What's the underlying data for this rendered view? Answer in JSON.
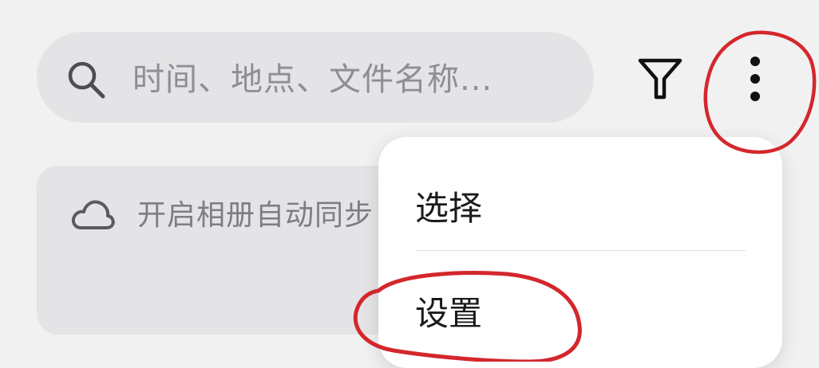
{
  "search": {
    "icon": "search-icon",
    "placeholder": "时间、地点、文件名称..."
  },
  "toolbar": {
    "filter_icon": "filter-icon",
    "more_icon": "more-vertical-icon"
  },
  "sync_banner": {
    "icon": "cloud-icon",
    "text": "开启相册自动同步"
  },
  "menu": {
    "items": [
      {
        "label": "选择"
      },
      {
        "label": "设置"
      }
    ]
  },
  "colors": {
    "background": "#f1f1f2",
    "panel": "#e4e4e6",
    "menu_background": "#ffffff",
    "annotation_red": "#d4272c"
  }
}
